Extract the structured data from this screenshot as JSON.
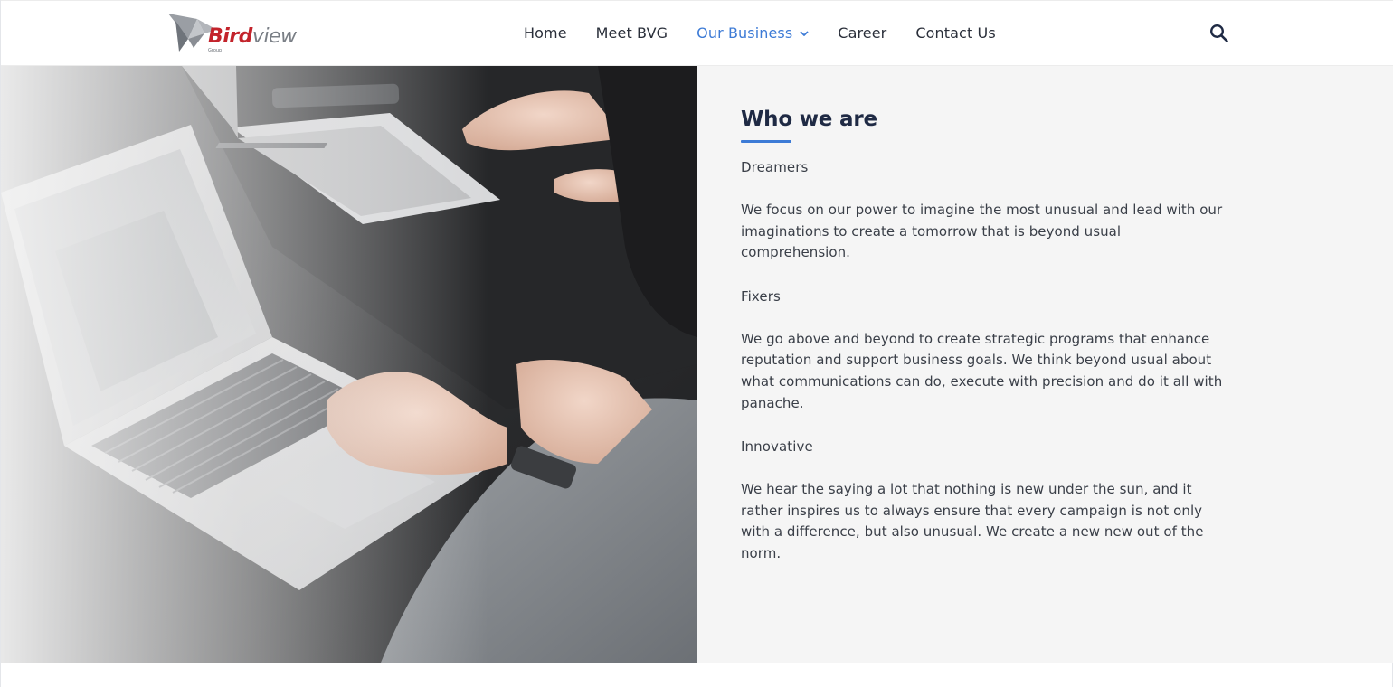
{
  "header": {
    "logo": {
      "brand_main": "Bird",
      "brand_rest": "view",
      "brand_sub": "Group"
    },
    "nav": [
      {
        "label": "Home",
        "active": false
      },
      {
        "label": "Meet BVG",
        "active": false
      },
      {
        "label": "Our Business",
        "active": true,
        "has_dropdown": true
      },
      {
        "label": "Career",
        "active": false
      },
      {
        "label": "Contact Us",
        "active": false
      }
    ],
    "search_icon": "search-icon",
    "accent_color": "#3d7bd6"
  },
  "hero": {
    "image": "photo of hands typing on laptops on a dark table"
  },
  "about": {
    "title": "Who we are",
    "sections": [
      {
        "heading": "Dreamers",
        "text": "We focus on our power to imagine the most unusual and lead with our imaginations to create a tomorrow that is beyond usual comprehension."
      },
      {
        "heading": "Fixers",
        "text": "We go above and beyond to create strategic programs that enhance reputation and support business goals. We think beyond usual about what communications can do, execute with precision and do it all with panache."
      },
      {
        "heading": "Innovative",
        "text": "We hear the saying a lot that nothing is new under the sun, and it rather inspires us to always ensure that every campaign is not only with a difference, but also unusual. We create a new new out of the norm."
      }
    ]
  },
  "colors": {
    "title": "#1f2a44",
    "body_text": "#3a3f48",
    "panel_bg": "#f5f5f5",
    "brand_red": "#c3232b"
  }
}
